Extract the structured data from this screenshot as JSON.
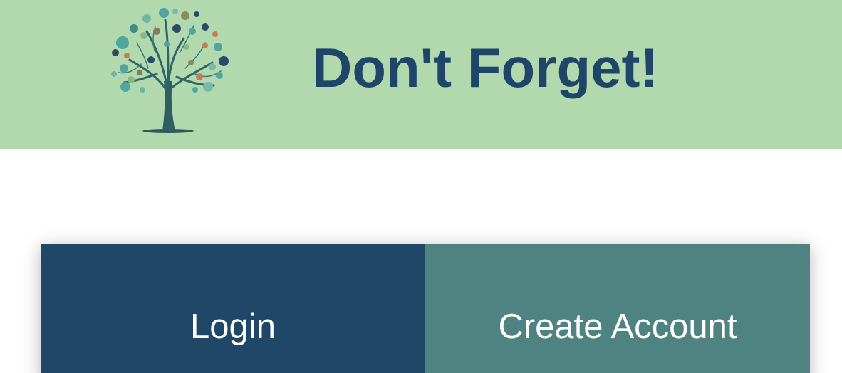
{
  "header": {
    "title": "Don't Forget!",
    "logo_icon": "tree-icon",
    "background": "#b2d9ae",
    "title_color": "#1f4668"
  },
  "auth": {
    "tabs": [
      {
        "label": "Login",
        "color": "#204668"
      },
      {
        "label": "Create Account",
        "color": "#4f8382"
      }
    ]
  }
}
